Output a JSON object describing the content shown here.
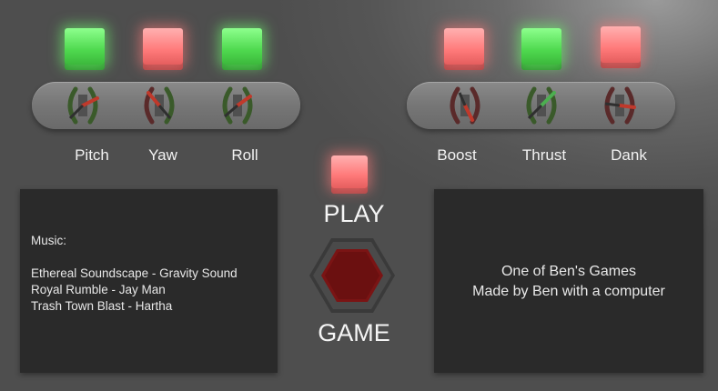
{
  "lights": {
    "pitch": "green",
    "yaw": "red",
    "roll": "green",
    "boost": "red",
    "thrust": "green",
    "dank": "red",
    "play": "red"
  },
  "controls_left": [
    "Pitch",
    "Yaw",
    "Roll"
  ],
  "controls_right": [
    "Boost",
    "Thrust",
    "Dank"
  ],
  "play_label": "PLAY",
  "game_label": "GAME",
  "credits": {
    "heading": "Music:",
    "tracks": [
      "Ethereal Soundscape - Gravity Sound",
      "Royal Rumble - Jay Man",
      "Trash Town Blast - Hartha"
    ]
  },
  "info": {
    "line1": "One of Ben's Games",
    "line2": "Made by Ben with a computer"
  },
  "colors": {
    "light_green": "#5fe65f",
    "light_red": "#ff8a8a",
    "button_red": "#7a1414",
    "panel_dark": "#2a2a2a"
  }
}
